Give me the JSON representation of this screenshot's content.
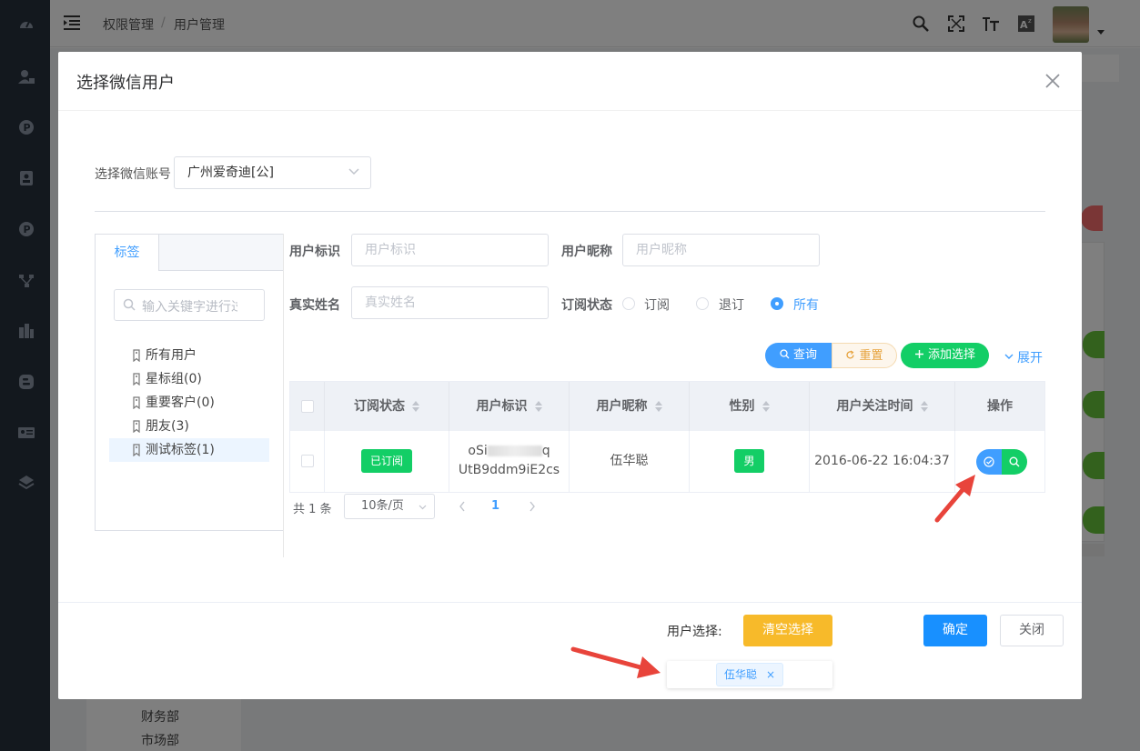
{
  "app": {
    "breadcrumb": [
      "权限管理",
      "用户管理"
    ],
    "breadcrumb_sep": "/",
    "bg_tree_items": [
      "财务部",
      "市场部"
    ],
    "sidebar_icons": [
      "dashboard-icon",
      "user-lock-icon",
      "p-icon",
      "contacts-icon",
      "p2-icon",
      "org-chart-icon",
      "building-icon",
      "blogger-icon",
      "id-card-icon",
      "layers-icon"
    ],
    "header_icons": [
      "search-icon",
      "fullscreen-icon",
      "font-size-icon",
      "translate-icon",
      "avatar",
      "dropdown-caret-icon"
    ]
  },
  "modal": {
    "title": "选择微信用户",
    "account_label": "选择微信账号",
    "account_value": "广州爱奇迪[公]",
    "tag_tab": "标签",
    "tree_search_placeholder": "输入关键字进行过滤",
    "tree": [
      {
        "label": "所有用户",
        "selected": false
      },
      {
        "label": "星标组(0)",
        "selected": false
      },
      {
        "label": "重要客户(0)",
        "selected": false
      },
      {
        "label": "朋友(3)",
        "selected": false
      },
      {
        "label": "测试标签(1)",
        "selected": true
      }
    ],
    "filters": {
      "user_id_label": "用户标识",
      "user_id_placeholder": "用户标识",
      "nickname_label": "用户昵称",
      "nickname_placeholder": "用户昵称",
      "realname_label": "真实姓名",
      "realname_placeholder": "真实姓名",
      "sub_status_label": "订阅状态",
      "radio_options": [
        "订阅",
        "退订",
        "所有"
      ],
      "radio_selected": "所有"
    },
    "buttons": {
      "query": "查询",
      "reset": "重置",
      "add_select": "添加选择",
      "expand": "展开"
    },
    "table": {
      "headers": [
        "订阅状态",
        "用户标识",
        "用户昵称",
        "性别",
        "用户关注时间",
        "操作"
      ],
      "rows": [
        {
          "status": "已订阅",
          "id_line1": "oSi",
          "id_line1_tail": "q",
          "id_line2": "UtB9ddm9iE2cs",
          "nickname": "伍华聪",
          "gender": "男",
          "follow_time": "2016-06-22 16:04:37"
        }
      ]
    },
    "pagination": {
      "total": "共 1 条",
      "page_size": "10条/页",
      "current_page": "1"
    },
    "footer": {
      "user_select_label": "用户选择:",
      "clear": "清空选择",
      "ok": "确定",
      "close": "关闭",
      "selected_chips": [
        "伍华聪"
      ],
      "chip_close": "×"
    }
  },
  "colors": {
    "primary": "#409eff",
    "success": "#13ce66",
    "warning": "#f7ba2a",
    "sidebar": "#27313d",
    "annotation_arrow": "#e8443b"
  }
}
